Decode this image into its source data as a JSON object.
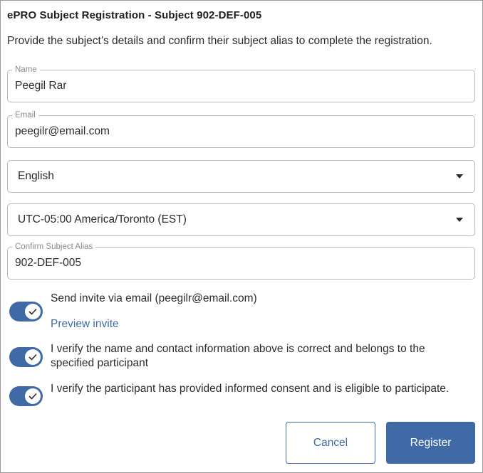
{
  "dialog": {
    "title": "ePRO Subject Registration - Subject 902-DEF-005",
    "description": "Provide the subject’s details and confirm their subject alias to complete the registration."
  },
  "form": {
    "name": {
      "label": "Name",
      "value": "Peegil Rar"
    },
    "email": {
      "label": "Email",
      "value": "peegilr@email.com"
    },
    "language": {
      "value": "English"
    },
    "timezone": {
      "value": "UTC-05:00 America/Toronto (EST)"
    },
    "alias": {
      "label": "Confirm Subject Alias",
      "value": "902-DEF-005"
    }
  },
  "toggles": {
    "send_invite": {
      "label": "Send invite via email (peegilr@email.com)",
      "on": true
    },
    "preview_link": "Preview invite",
    "verify_contact": {
      "label": "I verify the name and contact information above is correct and belongs to the specified participant",
      "on": true
    },
    "verify_consent": {
      "label": "I verify the participant has provided informed consent and is eligible to participate.",
      "on": true
    }
  },
  "buttons": {
    "cancel": "Cancel",
    "register": "Register"
  },
  "colors": {
    "accent": "#3f6aa6",
    "border": "#b8b8b8"
  },
  "icons": {
    "toggle_knob": "check-icon",
    "select_arrow": "caret-down-icon"
  }
}
